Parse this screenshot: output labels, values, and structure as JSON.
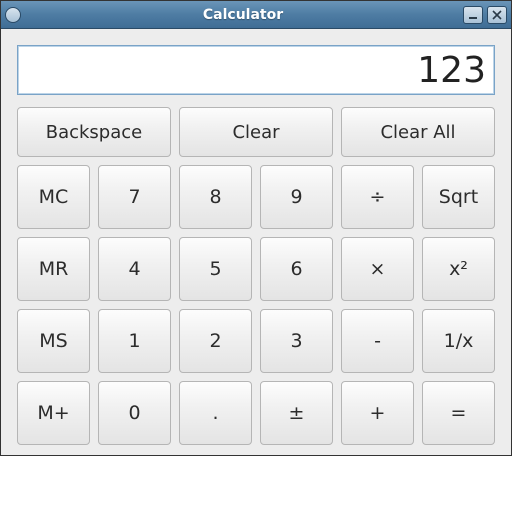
{
  "window": {
    "title": "Calculator"
  },
  "display": {
    "value": "123"
  },
  "top_buttons": {
    "backspace": "Backspace",
    "clear": "Clear",
    "clear_all": "Clear All"
  },
  "grid": {
    "r0": {
      "c0": "MC",
      "c1": "7",
      "c2": "8",
      "c3": "9",
      "c4": "÷",
      "c5": "Sqrt"
    },
    "r1": {
      "c0": "MR",
      "c1": "4",
      "c2": "5",
      "c3": "6",
      "c4": "×",
      "c5": "x²"
    },
    "r2": {
      "c0": "MS",
      "c1": "1",
      "c2": "2",
      "c3": "3",
      "c4": "-",
      "c5": "1/x"
    },
    "r3": {
      "c0": "M+",
      "c1": "0",
      "c2": ".",
      "c3": "±",
      "c4": "+",
      "c5": "="
    }
  }
}
